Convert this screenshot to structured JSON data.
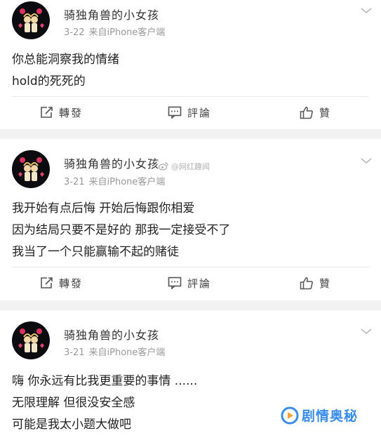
{
  "colors": {
    "background": "#f2f2f2",
    "card": "#ffffff",
    "text": "#222222",
    "meta": "#999999",
    "brand": "#3a8de8"
  },
  "posts": [
    {
      "username": "骑独角兽的小女孩",
      "date": "3-22",
      "source": "来自iPhone客户端",
      "lines": [
        "你总能洞察我的情绪",
        "hold的死死的"
      ],
      "actions": {
        "repost": "轉發",
        "comment": "評論",
        "like": "贊"
      }
    },
    {
      "username": "骑独角兽的小女孩",
      "date": "3-21",
      "source": "来自iPhone客户端",
      "lines": [
        "我开始有点后悔 开始后悔跟你相爱",
        "因为结局只要不是好的 那我一定接受不了",
        "我当了一个只能赢输不起的赌徒"
      ],
      "actions": {
        "repost": "轉發",
        "comment": "評論",
        "like": "贊"
      }
    },
    {
      "username": "骑独角兽的小女孩",
      "date": "3-21",
      "source": "来自iPhone客户端",
      "lines": [
        "嗨 你永远有比我更重要的事情 ......",
        "无限理解 但很没安全感",
        "可能是我太小题大做吧"
      ]
    }
  ],
  "watermark": "@网红趣闻",
  "brand": "剧情奥秘",
  "icons": [
    "avatar-image",
    "chevron-down-icon",
    "repost-icon",
    "comment-icon",
    "like-icon",
    "weibo-icon",
    "play-icon"
  ]
}
